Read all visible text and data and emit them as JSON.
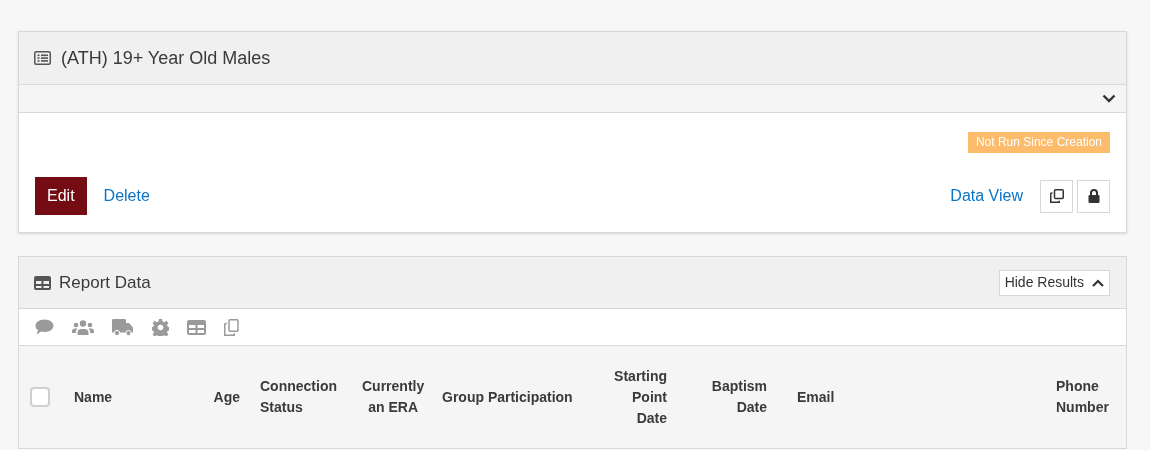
{
  "report": {
    "title": "(ATH) 19+ Year Old Males",
    "status_badge": "Not Run Since Creation",
    "actions": [
      {
        "kind": "primary",
        "label": "Edit"
      },
      {
        "kind": "link",
        "label": "Delete"
      }
    ],
    "data_view_link": "Data View",
    "icon_buttons": [
      {
        "kind": "copy"
      },
      {
        "kind": "lock"
      }
    ]
  },
  "report_data": {
    "title": "Report Data",
    "toggle_button": "Hide Results",
    "toolbar_icons": [
      {
        "kind": "comment"
      },
      {
        "kind": "users"
      },
      {
        "kind": "truck"
      },
      {
        "kind": "gear"
      },
      {
        "kind": "table"
      },
      {
        "kind": "copy"
      }
    ],
    "select_all_checked": false,
    "columns": [
      {
        "label": "Name"
      },
      {
        "label": "Age"
      },
      {
        "label": "Connection Status"
      },
      {
        "label": "Currently an ERA"
      },
      {
        "label": "Group Participation"
      },
      {
        "label": "Starting Point Date"
      },
      {
        "label": "Baptism Date"
      },
      {
        "label": "Email"
      },
      {
        "label": "Phone Number"
      }
    ]
  }
}
